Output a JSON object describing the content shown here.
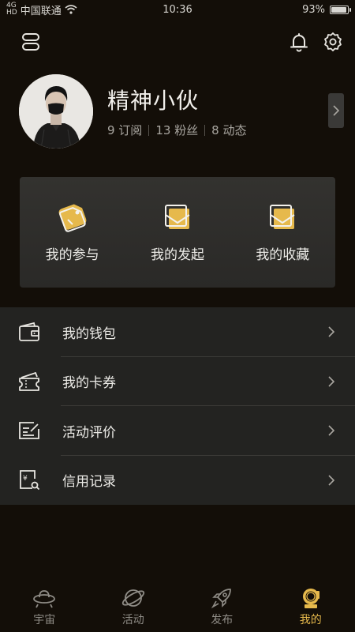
{
  "status_bar": {
    "signal_top": "4G",
    "signal_bottom": "HD",
    "carrier": "中国联通",
    "time": "10:36",
    "battery": "93%",
    "battery_level": 0.93
  },
  "toolbar": {
    "left_icon": "menu-icon",
    "right_icons": [
      "bell-icon",
      "gear-icon"
    ]
  },
  "profile": {
    "username": "精神小伙",
    "stats": [
      "9 订阅",
      "13 粉丝",
      "8 动态"
    ]
  },
  "actions": [
    {
      "label": "我的参与",
      "icon": "tag-icon"
    },
    {
      "label": "我的发起",
      "icon": "envelope-icon"
    },
    {
      "label": "我的收藏",
      "icon": "envelope-icon"
    }
  ],
  "menu": [
    {
      "label": "我的钱包",
      "icon": "wallet-icon"
    },
    {
      "label": "我的卡券",
      "icon": "ticket-icon"
    },
    {
      "label": "活动评价",
      "icon": "review-icon"
    },
    {
      "label": "信用记录",
      "icon": "credit-icon"
    }
  ],
  "nav": [
    {
      "label": "宇宙",
      "icon": "ufo-icon",
      "active": false
    },
    {
      "label": "活动",
      "icon": "planet-icon",
      "active": false
    },
    {
      "label": "发布",
      "icon": "rocket-icon",
      "active": false
    },
    {
      "label": "我的",
      "icon": "astronaut-icon",
      "active": true
    }
  ],
  "colors": {
    "background": "#130e08",
    "card": "#2f2e2b",
    "menu_bg": "#232321",
    "accent": "#e6b94c",
    "text": "#ecebe7",
    "muted": "#a9a6a0"
  }
}
